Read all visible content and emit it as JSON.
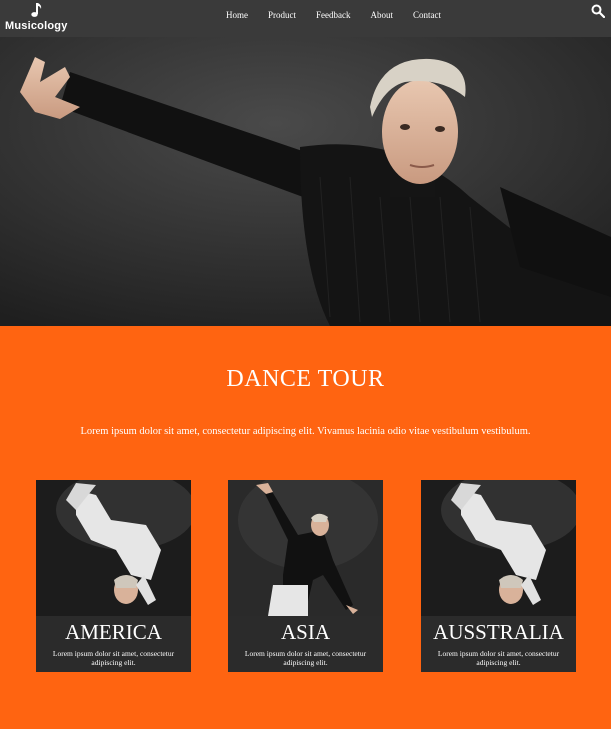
{
  "brand": {
    "name": "Musicology",
    "logo_icon": "music-note-icon"
  },
  "nav": {
    "items": [
      {
        "label": "Home"
      },
      {
        "label": "Product"
      },
      {
        "label": "Feedback"
      },
      {
        "label": "About"
      },
      {
        "label": "Contact"
      }
    ],
    "search_icon": "search-icon"
  },
  "hero": {
    "image": "dancer-black-sweater-photo"
  },
  "tour": {
    "title": "DANCE TOUR",
    "description": "Lorem ipsum dolor sit amet, consectetur adipiscing elit. Vivamus lacinia odio vitae vestibulum vestibulum.",
    "cards": [
      {
        "name": "AMERICA",
        "text": "Lorem ipsum dolor sit amet, consectetur adipiscing elit.",
        "image": "breakdancer-white-outfit-photo"
      },
      {
        "name": "ASIA",
        "text": "Lorem ipsum dolor sit amet, consectetur adipiscing elit.",
        "image": "dancer-black-sweater-photo"
      },
      {
        "name": "AUSSTRALIA",
        "text": "Lorem ipsum dolor sit amet, consectetur adipiscing elit.",
        "image": "breakdancer-white-outfit-photo"
      }
    ]
  },
  "colors": {
    "nav_bg": "#3a3a3a",
    "accent": "#ff6411",
    "card_bg": "#2b2b2b",
    "text": "#ffffff"
  }
}
